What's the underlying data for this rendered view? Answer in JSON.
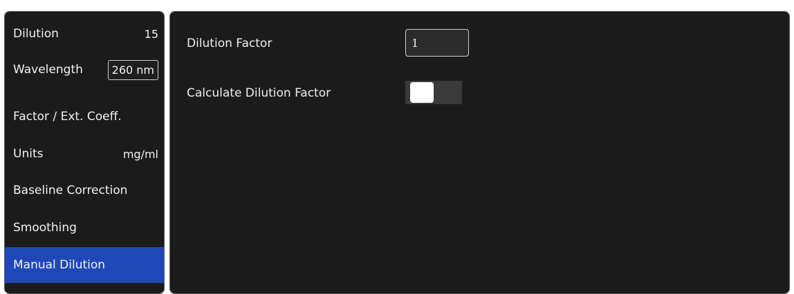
{
  "sidebar": {
    "items": [
      {
        "label": "Dilution",
        "value": "15"
      },
      {
        "label": "Wavelength",
        "value": "260 nm"
      },
      {
        "label": "Factor / Ext. Coeff."
      },
      {
        "label": "Units",
        "value": "mg/ml"
      },
      {
        "label": "Baseline Correction"
      },
      {
        "label": "Smoothing"
      },
      {
        "label": "Manual Dilution",
        "selected": true
      }
    ]
  },
  "main": {
    "dilution_factor_label": "Dilution Factor",
    "dilution_factor_value": "1",
    "calculate_label": "Calculate Dilution Factor",
    "calculate_toggle": "off"
  },
  "colors": {
    "background": "#1b1b1b",
    "selected": "#1f47b8",
    "border": "#5a5a5a"
  }
}
